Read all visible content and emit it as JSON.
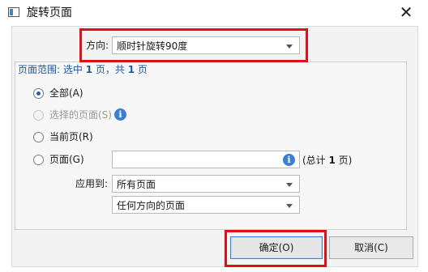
{
  "window": {
    "title": "旋转页面"
  },
  "direction": {
    "label": "方向:",
    "value": "顺时针旋转90度"
  },
  "page_range": {
    "prefix": "页面范围: 选中 ",
    "selected_count": "1",
    "middle": " 页，共 ",
    "total_count": "1",
    "suffix": " 页"
  },
  "options": {
    "all": "全部(A)",
    "selected_pages": "选择的页面(S)",
    "current_page": "当前页(R)",
    "pages": "页面(G)",
    "pages_input": "",
    "total_prefix": "(总计 ",
    "total_value": "1",
    "total_suffix": " 页)"
  },
  "apply_to": {
    "label": "应用到:",
    "pages_value": "所有页面",
    "orientation_value": "任何方向的页面"
  },
  "buttons": {
    "ok": "确定(O)",
    "cancel": "取消(C)"
  },
  "icons": {
    "close": "close-icon",
    "info": "info-icon",
    "app": "app-icon"
  },
  "colors": {
    "highlight": "#e0101a",
    "accent": "#2a5ea8"
  }
}
